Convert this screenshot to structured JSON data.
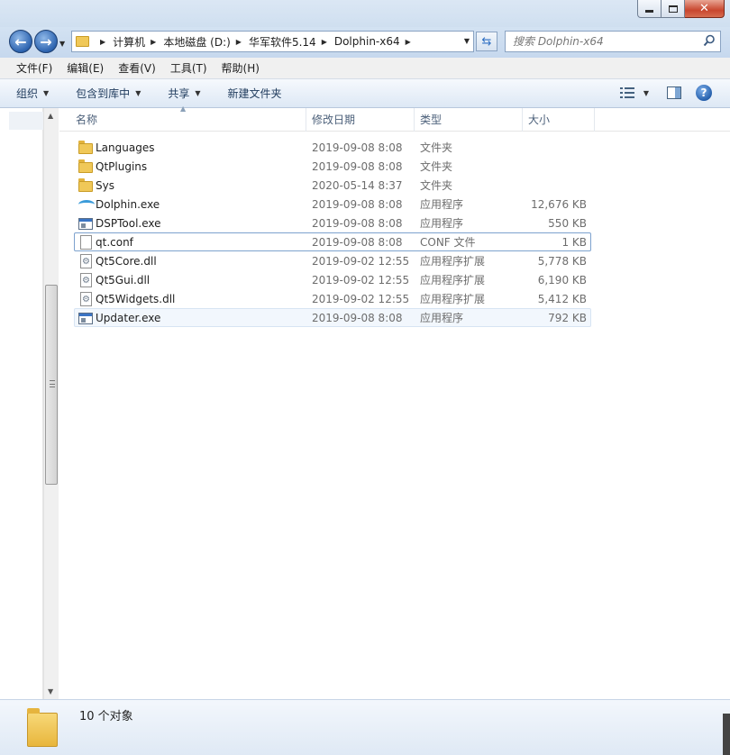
{
  "window": {
    "minimize_label": "–",
    "maximize_label": "□",
    "close_label": "✕"
  },
  "address": {
    "crumbs": [
      "计算机",
      "本地磁盘 (D:)",
      "华军软件5.14",
      "Dolphin-x64"
    ]
  },
  "search": {
    "placeholder": "搜索 Dolphin-x64"
  },
  "menu": {
    "items": [
      "文件(F)",
      "编辑(E)",
      "查看(V)",
      "工具(T)",
      "帮助(H)"
    ]
  },
  "commands": {
    "organize": "组织",
    "include_in_library": "包含到库中",
    "share": "共享",
    "new_folder": "新建文件夹"
  },
  "columns": {
    "name": "名称",
    "date": "修改日期",
    "type": "类型",
    "size": "大小"
  },
  "files": [
    {
      "name": "Languages",
      "date": "2019-09-08 8:08",
      "type": "文件夹",
      "size": "",
      "icon": "folder-icon"
    },
    {
      "name": "QtPlugins",
      "date": "2019-09-08 8:08",
      "type": "文件夹",
      "size": "",
      "icon": "folder-icon"
    },
    {
      "name": "Sys",
      "date": "2020-05-14 8:37",
      "type": "文件夹",
      "size": "",
      "icon": "folder-icon"
    },
    {
      "name": "Dolphin.exe",
      "date": "2019-09-08 8:08",
      "type": "应用程序",
      "size": "12,676 KB",
      "icon": "dolphin-app-icon"
    },
    {
      "name": "DSPTool.exe",
      "date": "2019-09-08 8:08",
      "type": "应用程序",
      "size": "550 KB",
      "icon": "application-icon"
    },
    {
      "name": "qt.conf",
      "date": "2019-09-08 8:08",
      "type": "CONF 文件",
      "size": "1 KB",
      "icon": "document-icon"
    },
    {
      "name": "Qt5Core.dll",
      "date": "2019-09-02 12:55",
      "type": "应用程序扩展",
      "size": "5,778 KB",
      "icon": "dll-icon"
    },
    {
      "name": "Qt5Gui.dll",
      "date": "2019-09-02 12:55",
      "type": "应用程序扩展",
      "size": "6,190 KB",
      "icon": "dll-icon"
    },
    {
      "name": "Qt5Widgets.dll",
      "date": "2019-09-02 12:55",
      "type": "应用程序扩展",
      "size": "5,412 KB",
      "icon": "dll-icon"
    },
    {
      "name": "Updater.exe",
      "date": "2019-09-08 8:08",
      "type": "应用程序",
      "size": "792 KB",
      "icon": "application-icon"
    }
  ],
  "status": {
    "count_text": "10 个对象"
  }
}
